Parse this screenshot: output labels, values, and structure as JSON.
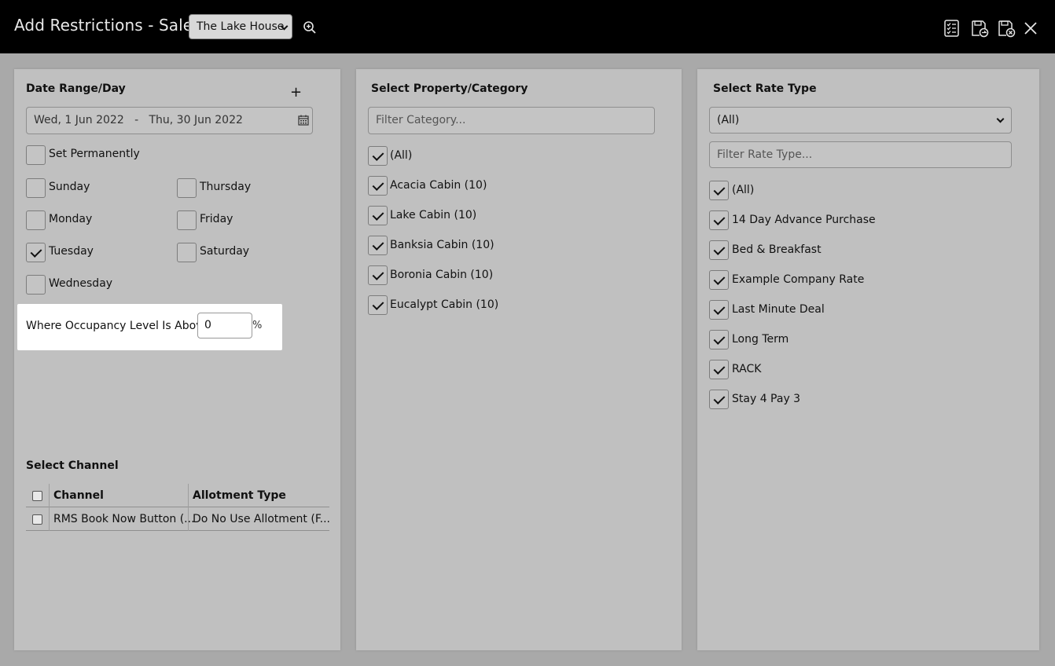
{
  "window": {
    "title": "Add Restrictions - Sale",
    "property_selected": "The Lake House",
    "icons": [
      "zoom-icon",
      "checklist-icon",
      "save-exit-icon",
      "save-close-icon",
      "close-icon"
    ]
  },
  "date_panel": {
    "title": "Date Range/Day",
    "add_label": "+",
    "date_range": "Wed, 1 Jun 2022   -   Thu, 30 Jun 2022",
    "set_permanently": {
      "label": "Set Permanently",
      "checked": false
    },
    "days": [
      {
        "label": "Sunday",
        "checked": false
      },
      {
        "label": "Thursday",
        "checked": false
      },
      {
        "label": "Monday",
        "checked": false
      },
      {
        "label": "Friday",
        "checked": false
      },
      {
        "label": "Tuesday",
        "checked": true
      },
      {
        "label": "Saturday",
        "checked": false
      },
      {
        "label": "Wednesday",
        "checked": false
      }
    ],
    "occupancy": {
      "label": "Where Occupancy Level Is Above",
      "value": "0",
      "unit": "%"
    }
  },
  "channel": {
    "title": "Select Channel",
    "columns": [
      "Channel",
      "Allotment Type"
    ],
    "rows": [
      {
        "channel": "RMS Book Now Button (...",
        "allotment": "Do No Use Allotment (F..."
      }
    ]
  },
  "category_panel": {
    "title": "Select Property/Category",
    "filter_placeholder": "Filter Category...",
    "items": [
      {
        "label": "(All)",
        "checked": true
      },
      {
        "label": "Acacia Cabin (10)",
        "checked": true
      },
      {
        "label": "Lake Cabin (10)",
        "checked": true
      },
      {
        "label": "Banksia Cabin (10)",
        "checked": true
      },
      {
        "label": "Boronia Cabin (10)",
        "checked": true
      },
      {
        "label": "Eucalypt Cabin (10)",
        "checked": true
      }
    ]
  },
  "rate_panel": {
    "title": "Select Rate Type",
    "dropdown_value": "(All)",
    "filter_placeholder": "Filter Rate Type...",
    "items": [
      {
        "label": "(All)",
        "checked": true
      },
      {
        "label": "14 Day Advance Purchase",
        "checked": true
      },
      {
        "label": "Bed & Breakfast",
        "checked": true
      },
      {
        "label": "Example Company Rate",
        "checked": true
      },
      {
        "label": "Last Minute Deal",
        "checked": true
      },
      {
        "label": "Long Term",
        "checked": true
      },
      {
        "label": "RACK",
        "checked": true
      },
      {
        "label": "Stay 4 Pay 3",
        "checked": true
      }
    ]
  }
}
